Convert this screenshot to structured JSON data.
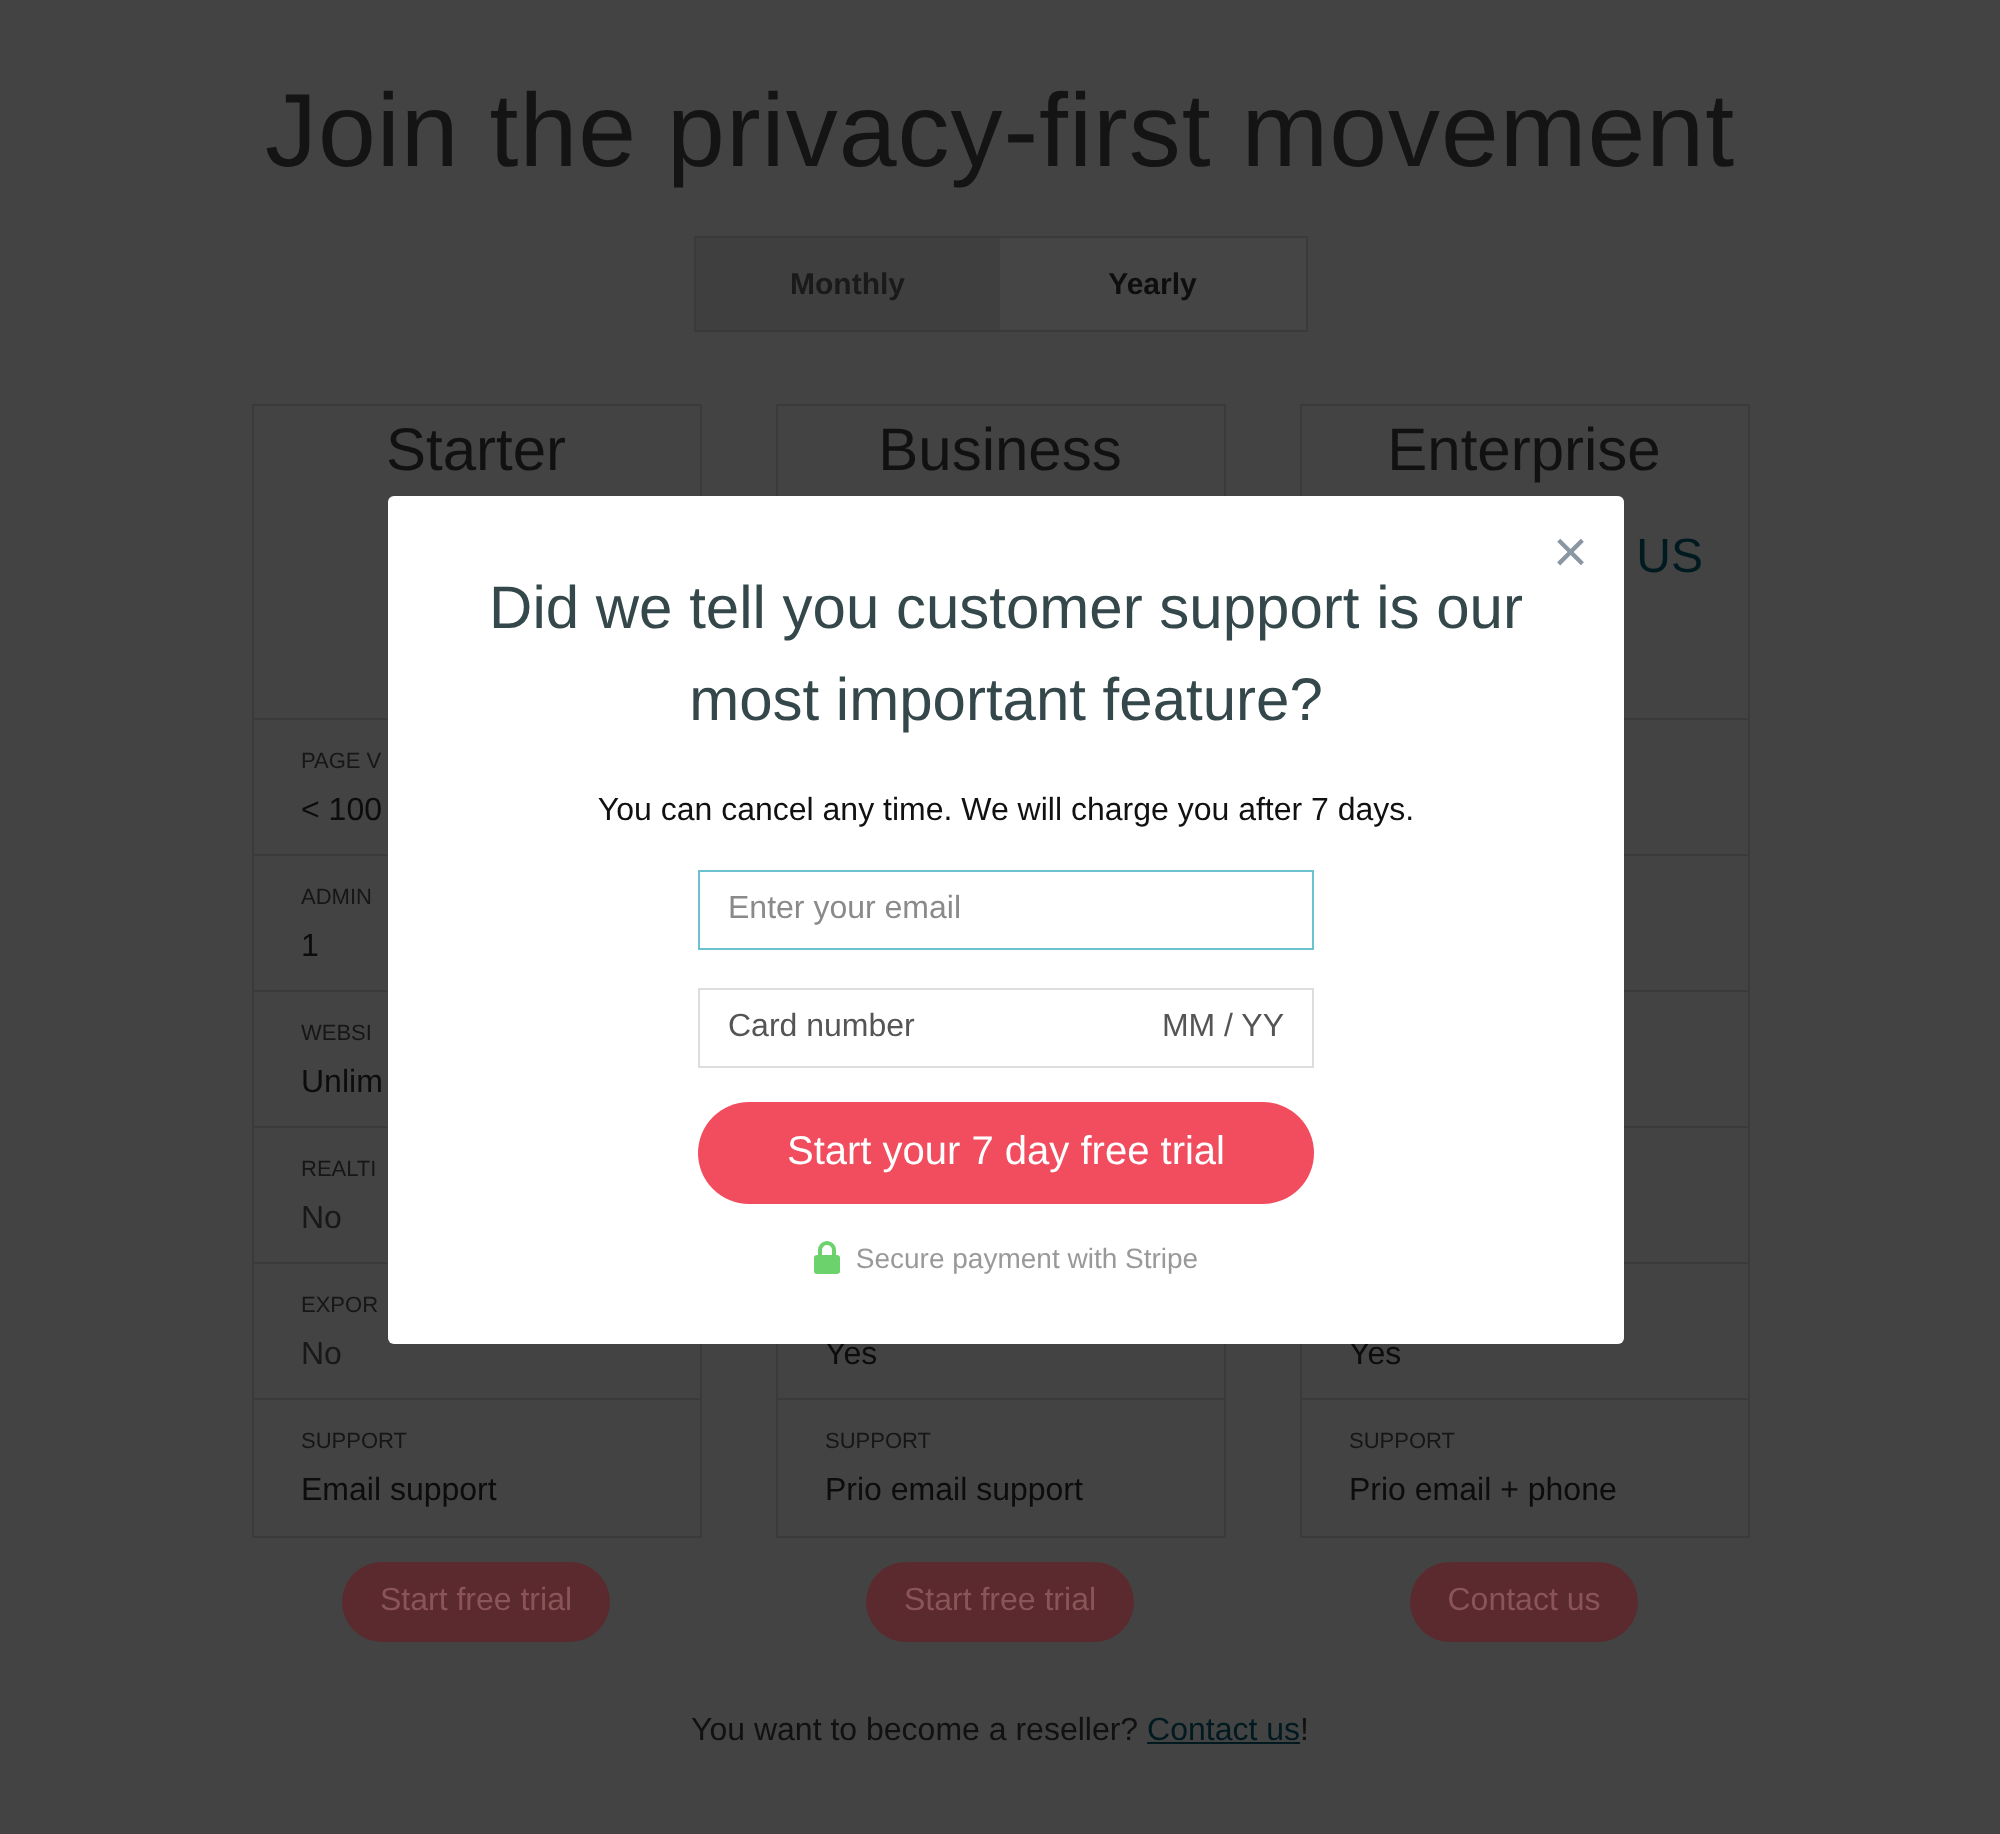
{
  "page": {
    "title": "Join the privacy-first movement",
    "billing_toggle": [
      {
        "label": "Monthly",
        "selected": false
      },
      {
        "label": "Yearly",
        "selected": true
      }
    ],
    "plans": [
      {
        "name": "Starter",
        "features": [
          {
            "label": "PAGE V",
            "value": "< 100",
            "available": true
          },
          {
            "label": "ADMIN",
            "value": "1",
            "available": true
          },
          {
            "label": "WEBSI",
            "value": "Unlim",
            "available": true
          },
          {
            "label": "REALTI",
            "value": "No",
            "available": false
          },
          {
            "label": "EXPOR",
            "value": "No",
            "available": false
          },
          {
            "label": "SUPPORT",
            "value": "Email support",
            "available": true
          }
        ],
        "cta": "Start free trial"
      },
      {
        "name": "Business",
        "features": [
          {
            "value": "Yes",
            "available": true
          },
          {
            "label": "SUPPORT",
            "value": "Prio email support",
            "available": true
          }
        ],
        "cta": "Start free trial"
      },
      {
        "name": "Enterprise",
        "price": "US",
        "features": [
          {
            "value": "Yes",
            "available": true
          },
          {
            "label": "SUPPORT",
            "value": "Prio email + phone",
            "available": true
          }
        ],
        "cta": "Contact us"
      }
    ],
    "reseller": {
      "text": "You want to become a reseller? ",
      "link": "Contact us",
      "end": "!"
    }
  },
  "modal": {
    "close": "×",
    "title": "Did we tell you customer support is our most important feature?",
    "subtitle": "You can cancel any time. We will charge you after 7 days.",
    "email": {
      "placeholder": "Enter your email"
    },
    "card": {
      "placeholder": "Card number",
      "expiry_placeholder": "MM / YY"
    },
    "submit": "Start your 7 day free trial",
    "secure_note": "Secure payment with Stripe"
  }
}
